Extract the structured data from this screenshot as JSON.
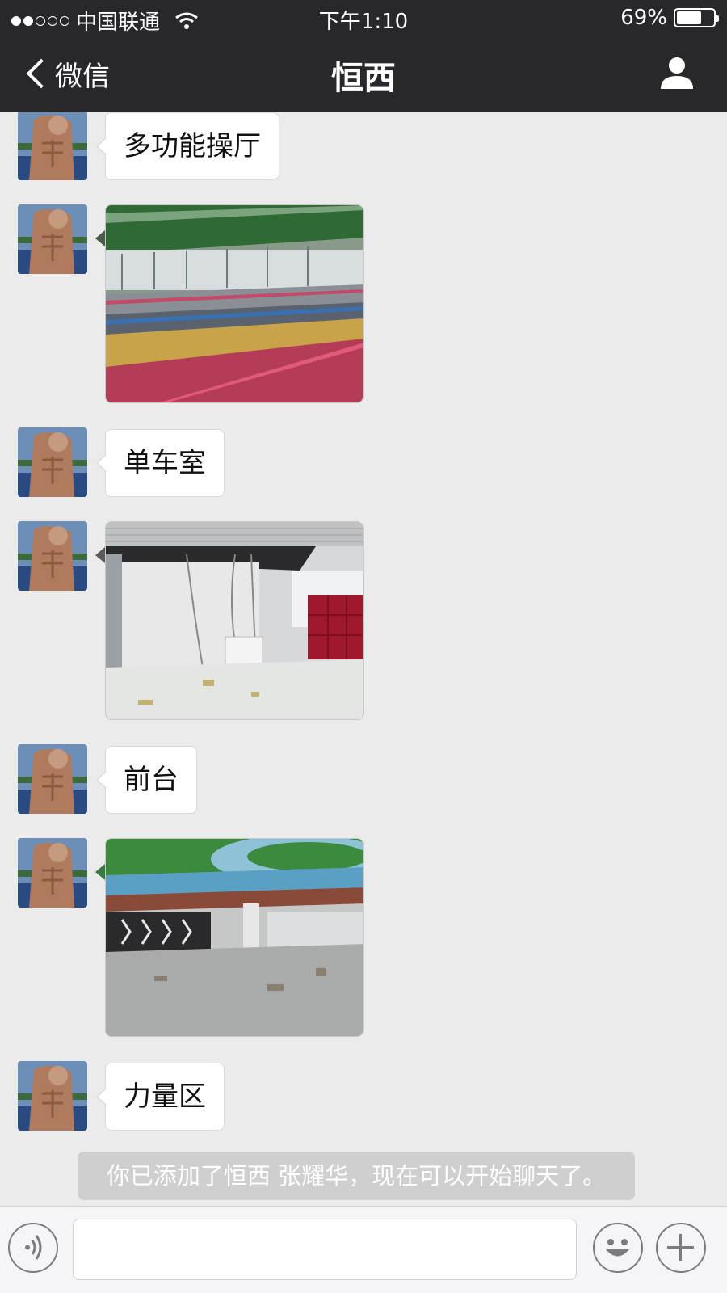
{
  "status_bar": {
    "carrier": "中国联通",
    "signal_bars_filled": 2,
    "signal_bars_total": 5,
    "time": "下午1:10",
    "battery_percent": "69%",
    "battery_level": 0.69
  },
  "nav": {
    "back_label": "微信",
    "title": "恒西"
  },
  "messages": [
    {
      "type": "text",
      "text": "多功能操厅"
    },
    {
      "type": "image",
      "scene": "multipurpose-hall"
    },
    {
      "type": "text",
      "text": "单车室"
    },
    {
      "type": "image",
      "scene": "spin-room"
    },
    {
      "type": "text",
      "text": "前台"
    },
    {
      "type": "image",
      "scene": "front-desk"
    },
    {
      "type": "text",
      "text": "力量区"
    }
  ],
  "system_notice": "你已添加了恒西 张耀华，现在可以开始聊天了。",
  "input": {
    "value": "",
    "placeholder": ""
  },
  "colors": {
    "header_bg": "#28282c",
    "chat_bg": "#ebebeb",
    "bubble_bg": "#ffffff",
    "input_bar_bg": "#f5f5f7"
  }
}
